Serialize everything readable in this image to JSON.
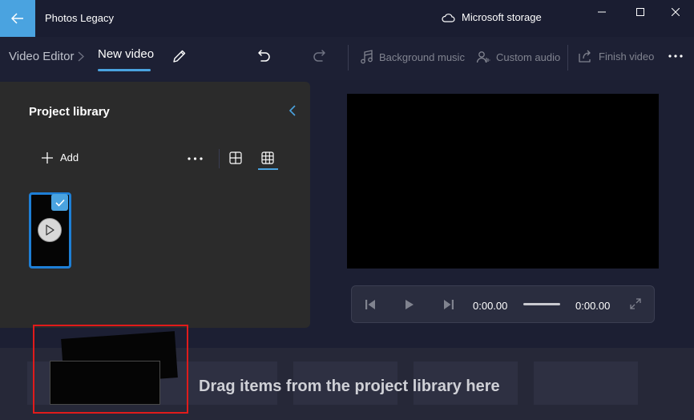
{
  "app": {
    "title": "Photos Legacy",
    "storage_label": "Microsoft storage",
    "accent": "#4aa3e0"
  },
  "command_bar": {
    "breadcrumb": [
      "Video Editor",
      "New video"
    ],
    "background_music": "Background music",
    "custom_audio": "Custom audio",
    "finish_video": "Finish video"
  },
  "library": {
    "title": "Project library",
    "add_label": "Add",
    "clips": [
      {
        "selected": true,
        "type": "video"
      }
    ]
  },
  "preview": {
    "current_time": "0:00.00",
    "total_time": "0:00.00"
  },
  "storyboard": {
    "hint": "Drag items from the project library here"
  },
  "icons": {
    "back": "arrow-left-icon",
    "storage": "cloud-icon",
    "edit": "pencil-icon",
    "undo": "undo-icon",
    "redo": "redo-icon",
    "music": "music-note-icon",
    "audio": "person-audio-icon",
    "export": "share-icon"
  }
}
